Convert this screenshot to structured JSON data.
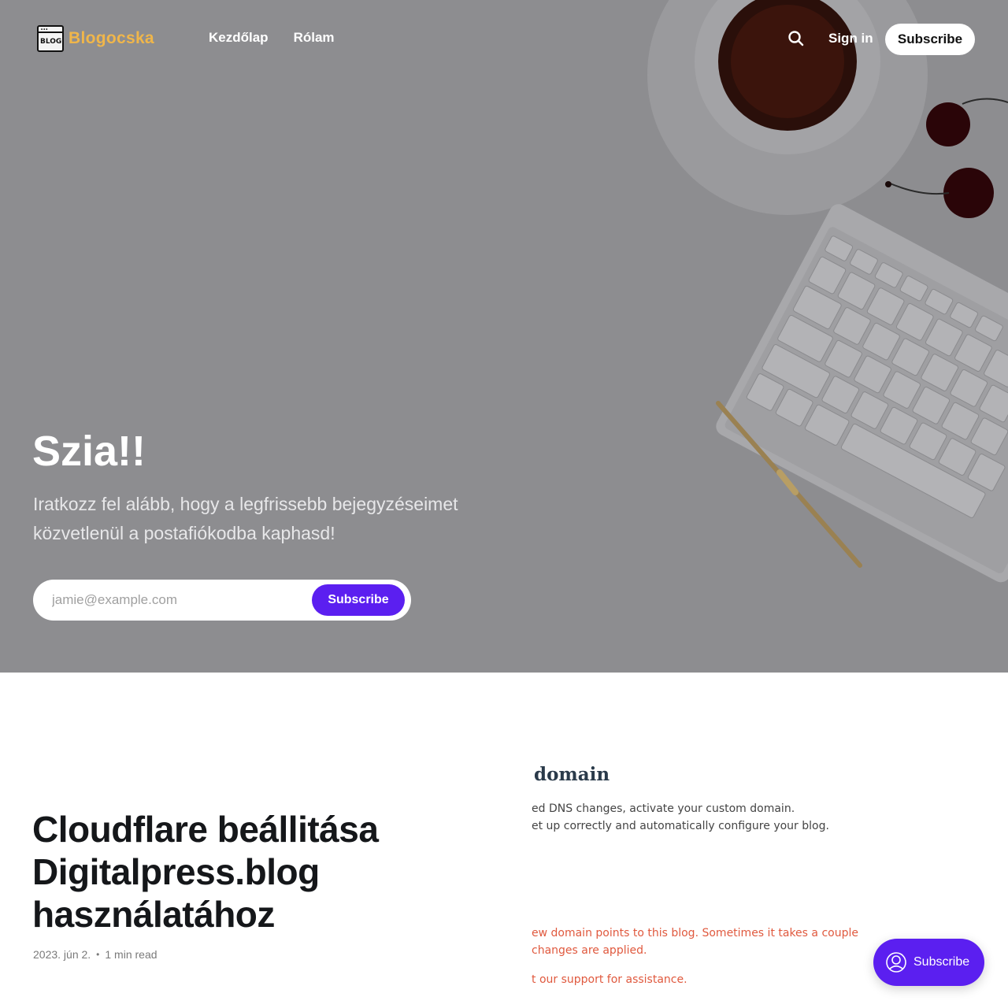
{
  "header": {
    "logo_text": "Blogocska",
    "logo_badge": "BLOG",
    "nav": [
      {
        "label": "Kezdőlap"
      },
      {
        "label": "Rólam"
      }
    ],
    "search_icon": "search-icon",
    "signin_label": "Sign in",
    "subscribe_label": "Subscribe"
  },
  "hero": {
    "title": "Szia!!",
    "subtitle": "Iratkozz fel alább, hogy a legfrissebb bejegyzéseimet közvetlenül a postafiókodba kaphasd!",
    "email_placeholder": "jamie@example.com",
    "subscribe_label": "Subscribe"
  },
  "post": {
    "title": "Cloudflare beállitása Digitalpress.blog használatához",
    "date": "2023. jún 2.",
    "read_time": "1 min read",
    "image": {
      "heading": "domain",
      "line1": "ed DNS changes, activate your custom domain.",
      "line2": "et up correctly and automatically configure your blog.",
      "red1": "ew domain points to this blog. Sometimes it takes a couple",
      "red2": "changes are applied.",
      "red3": "t our support for assistance."
    }
  },
  "portal": {
    "label": "Subscribe",
    "icon": "user-icon"
  },
  "colors": {
    "accent": "#5b1ff0",
    "logo": "#f0b64a",
    "hero_overlay": "#8c8c8f"
  }
}
